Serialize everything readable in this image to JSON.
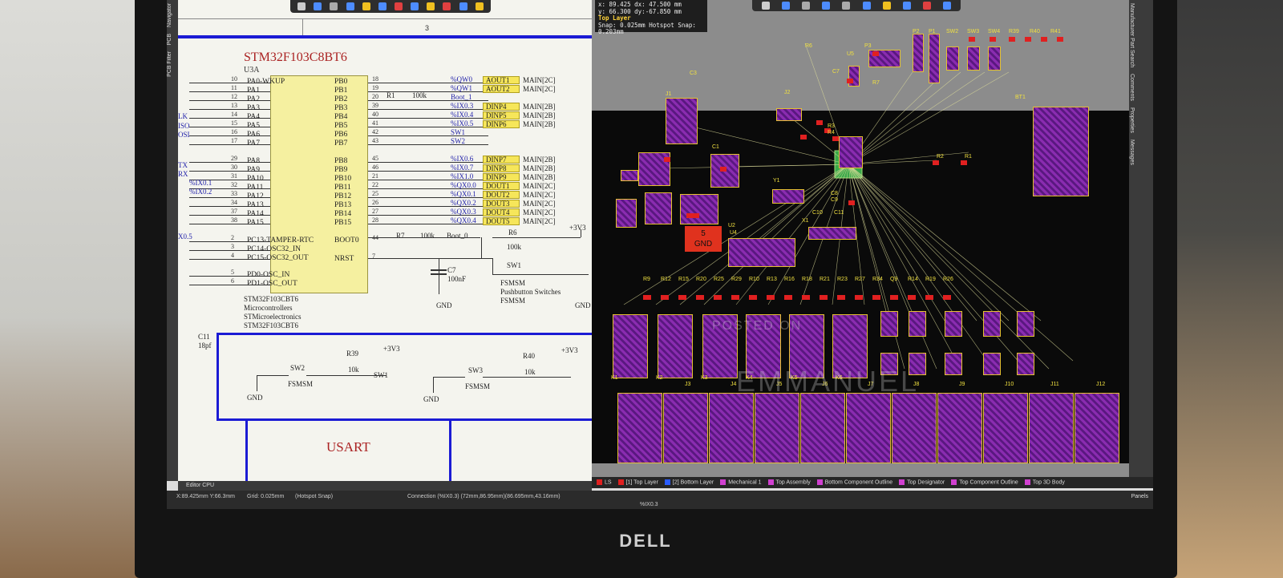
{
  "schematic": {
    "column_number": "3",
    "chip": {
      "title": "STM32F103C8BT6",
      "designator": "U3A",
      "left_pins": [
        {
          "num": "10",
          "name": "PA0-WKUP"
        },
        {
          "num": "11",
          "name": "PA1"
        },
        {
          "num": "12",
          "name": "PA2"
        },
        {
          "num": "13",
          "name": "PA3"
        },
        {
          "num": "14",
          "name": "PA4"
        },
        {
          "num": "15",
          "name": "PA5"
        },
        {
          "num": "16",
          "name": "PA6"
        },
        {
          "num": "17",
          "name": "PA7"
        },
        {
          "num": "29",
          "name": "PA8"
        },
        {
          "num": "30",
          "name": "PA9"
        },
        {
          "num": "31",
          "name": "PA10"
        },
        {
          "num": "32",
          "name": "PA11"
        },
        {
          "num": "33",
          "name": "PA12"
        },
        {
          "num": "34",
          "name": "PA13"
        },
        {
          "num": "37",
          "name": "PA14"
        },
        {
          "num": "38",
          "name": "PA15"
        },
        {
          "num": "2",
          "name": "PC13-TAMPER-RTC"
        },
        {
          "num": "3",
          "name": "PC14-OSC32_IN"
        },
        {
          "num": "4",
          "name": "PC15-OSC32_OUT"
        },
        {
          "num": "5",
          "name": "PD0-OSC_IN"
        },
        {
          "num": "6",
          "name": "PD1-OSC_OUT"
        }
      ],
      "right_pins": [
        {
          "num": "18",
          "name": "PB0",
          "net": "%QW0",
          "port": "AOUT1",
          "harness": "MAIN[2C]"
        },
        {
          "num": "19",
          "name": "PB1",
          "net": "%QW1",
          "port": "AOUT2",
          "harness": "MAIN[2C]"
        },
        {
          "num": "20",
          "name": "PB2",
          "net": "Boot_1",
          "port": "",
          "harness": ""
        },
        {
          "num": "39",
          "name": "PB3",
          "net": "%IX0.3",
          "port": "DINP4",
          "harness": "MAIN[2B]"
        },
        {
          "num": "40",
          "name": "PB4",
          "net": "%IX0.4",
          "port": "DINP5",
          "harness": "MAIN[2B]"
        },
        {
          "num": "41",
          "name": "PB5",
          "net": "%IX0.5",
          "port": "DINP6",
          "harness": "MAIN[2B]"
        },
        {
          "num": "42",
          "name": "PB6",
          "net": "SW1",
          "port": "",
          "harness": ""
        },
        {
          "num": "43",
          "name": "PB7",
          "net": "SW2",
          "port": "",
          "harness": ""
        },
        {
          "num": "45",
          "name": "PB8",
          "net": "%IX0.6",
          "port": "DINP7",
          "harness": "MAIN[2B]"
        },
        {
          "num": "46",
          "name": "PB9",
          "net": "%IX0.7",
          "port": "DINP8",
          "harness": "MAIN[2B]"
        },
        {
          "num": "21",
          "name": "PB10",
          "net": "%IX1.0",
          "port": "DINP9",
          "harness": "MAIN[2B]"
        },
        {
          "num": "22",
          "name": "PB11",
          "net": "%QX0.0",
          "port": "DOUT1",
          "harness": "MAIN[2C]"
        },
        {
          "num": "25",
          "name": "PB12",
          "net": "%QX0.1",
          "port": "DOUT2",
          "harness": "MAIN[2C]"
        },
        {
          "num": "26",
          "name": "PB13",
          "net": "%QX0.2",
          "port": "DOUT3",
          "harness": "MAIN[2C]"
        },
        {
          "num": "27",
          "name": "PB14",
          "net": "%QX0.3",
          "port": "DOUT4",
          "harness": "MAIN[2C]"
        },
        {
          "num": "28",
          "name": "PB15",
          "net": "%QX0.4",
          "port": "DOUT5",
          "harness": "MAIN[2C]"
        },
        {
          "num": "44",
          "name": "BOOT0",
          "net": "Boot_0",
          "port": "",
          "harness": ""
        },
        {
          "num": "7",
          "name": "NRST",
          "net": "",
          "port": "",
          "harness": ""
        }
      ],
      "left_nets": [
        "LK",
        "ISO",
        "OSI",
        "TX",
        "RX",
        "%IX0.1",
        "%IX0.2",
        "X0.5"
      ],
      "part_info": [
        "STM32F103CBT6",
        "Microcontrollers",
        "STMicroelectronics",
        "STM32F103CBT6"
      ]
    },
    "components": {
      "r1": "R1",
      "r1_val": "100k",
      "r7": "R7",
      "r7_val": "100k",
      "r6": "R6",
      "r6_val": "100k",
      "v33": "+3V3",
      "c7": "C7",
      "c7_val": "100nF",
      "gnd": "GND",
      "sw1": "SW1",
      "sw1_model": "FSMSM",
      "sw1_desc": "Pushbutton Switches",
      "sw1_model2": "FSMSM",
      "c11": "C11",
      "c11_val": "18pf",
      "sw2": "SW2",
      "sw2_model": "FSMSM",
      "r39": "R39",
      "r39_val": "10k",
      "sw1_net": "SW1",
      "sw3": "SW3",
      "sw3_model": "FSMSM",
      "r40": "R40",
      "r40_val": "10k"
    },
    "section_title": "USART",
    "editor_tabs": "Editor   CPU"
  },
  "left_panel_tabs": [
    "Navigator",
    "PCB",
    "PCB Filter"
  ],
  "right_panel_tabs": [
    "Manufacturer Part Search",
    "Comments",
    "Properties",
    "Messages"
  ],
  "pcb": {
    "info": {
      "line1": "x: 89.425  dx: 47.500 mm",
      "line2": "y: 66.300  dy:-67.850 mm",
      "layer": "Top Layer",
      "snap": "Snap: 0.025mm Hotspot Snap: 0.203mm"
    },
    "refs_top": [
      "P2",
      "P1",
      "SW2",
      "SW3",
      "SW4",
      "R39",
      "R40",
      "R41",
      "R6",
      "P3",
      "C7",
      "R7",
      "J1",
      "J2",
      "R3",
      "R4",
      "C3",
      "C1",
      "BT1",
      "Y1",
      "X1",
      "R2",
      "R1",
      "C10",
      "C11",
      "C8",
      "C9"
    ],
    "refs_row": [
      "R9",
      "R12",
      "R15",
      "R20",
      "R25",
      "R29",
      "R10",
      "R13",
      "R16",
      "R18",
      "R21",
      "R23",
      "R27",
      "R34",
      "Q9",
      "R14",
      "R19",
      "R26"
    ],
    "relays": [
      "K1",
      "K2",
      "K3",
      "K4",
      "K5",
      "K6"
    ],
    "connectors": [
      "J3",
      "J4",
      "J5",
      "J6",
      "J7",
      "J8",
      "J9",
      "J10",
      "J11",
      "J12"
    ],
    "chips": [
      "U2",
      "U4",
      "U5"
    ],
    "gnd_label": "GND",
    "gnd_num": "5",
    "watermark1": "POSTED ON",
    "watermark2": "EMMANUEL"
  },
  "layers": [
    {
      "name": "LS",
      "color": "#e02020"
    },
    {
      "name": "[1] Top Layer",
      "color": "#e02020"
    },
    {
      "name": "[2] Bottom Layer",
      "color": "#2a5cff"
    },
    {
      "name": "Mechanical 1",
      "color": "#d040d0"
    },
    {
      "name": "Top Assembly",
      "color": "#d040d0"
    },
    {
      "name": "Bottom Component Outline",
      "color": "#d040d0"
    },
    {
      "name": "Top Designator",
      "color": "#d040d0"
    },
    {
      "name": "Top Component Outline",
      "color": "#d040d0"
    },
    {
      "name": "Top 3D Body",
      "color": "#d040d0"
    }
  ],
  "status": {
    "coords": "X:89.425mm Y:66.3mm",
    "grid": "Grid: 0.025mm",
    "snap": "(Hotspot Snap)",
    "connection": "Connection (%IX0.3) (72mm,86.95mm)(86.695mm,43.16mm)",
    "net": "%IX0.3",
    "panels": "Panels"
  },
  "brand": "DELL"
}
